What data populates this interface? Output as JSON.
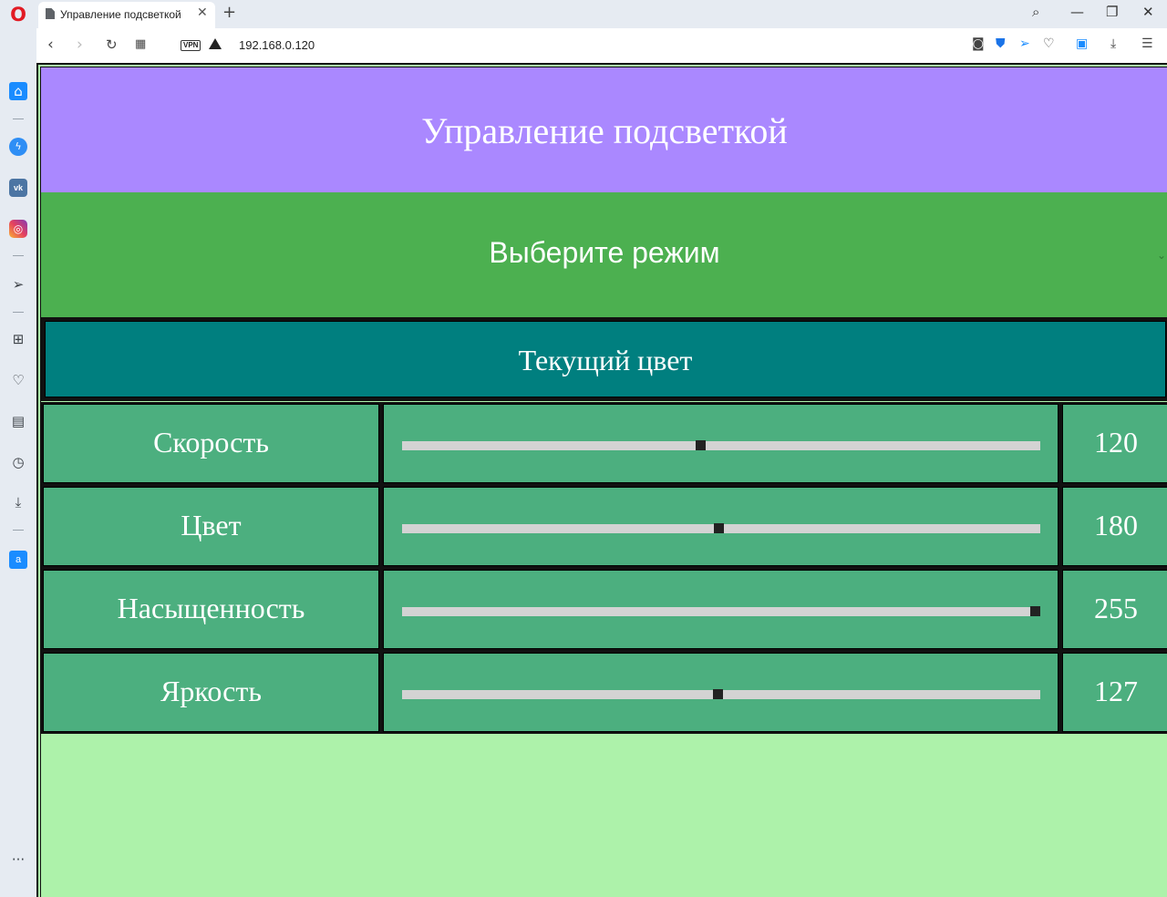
{
  "browser": {
    "tab_title": "Управление подсветкой",
    "url": "192.168.0.120",
    "vpn_label": "VPN"
  },
  "page": {
    "header_title": "Управление подсветкой",
    "mode_select": {
      "selected": "Выберите режим"
    },
    "current_color_label": "Текущий цвет",
    "colors": {
      "header_bg": "#aa88ff",
      "mode_bg": "#4cb050",
      "current_color_bg": "#007f7f",
      "row_bg": "#4caf7f",
      "page_bg": "#adf2aa",
      "track": "#d3d3d3",
      "thumb": "#222222"
    },
    "sliders": [
      {
        "label": "Скорость",
        "value": "120",
        "fraction": 0.471
      },
      {
        "label": "Цвет",
        "value": "180",
        "fraction": 0.5
      },
      {
        "label": "Насыщенность",
        "value": "255",
        "fraction": 1.0
      },
      {
        "label": "Яркость",
        "value": "127",
        "fraction": 0.498
      }
    ]
  },
  "icons": {
    "sidebar": [
      "home-icon",
      "messenger-icon",
      "vk-icon",
      "instagram-icon",
      "send-icon",
      "speed-dial-icon",
      "heart-icon",
      "news-icon",
      "history-icon",
      "downloads-icon",
      "translate-icon",
      "more-icon"
    ],
    "address_bar": [
      "camera-icon",
      "shield-icon",
      "send-icon",
      "heart-icon",
      "translate-icon",
      "download-icon",
      "settings-icon"
    ]
  }
}
